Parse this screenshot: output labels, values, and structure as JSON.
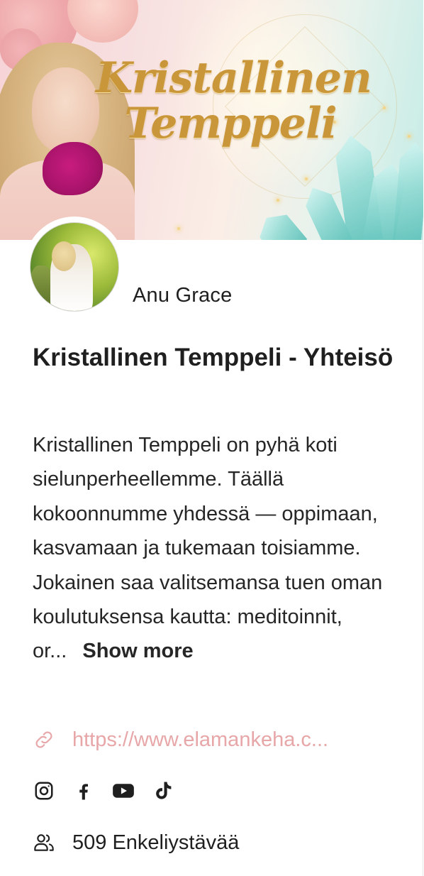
{
  "banner": {
    "title_line1": "Kristallinen",
    "title_line2": "Temppeli"
  },
  "owner": {
    "name": "Anu Grace"
  },
  "community": {
    "title": "Kristallinen Temppeli - Yhteisö",
    "description": "Kristallinen Temppeli on pyhä koti sielunperheellemme. Täällä kokoonnumme yhdessä — oppimaan, kasvamaan ja tukemaan toisiamme. Jokainen saa valitsemansa tuen oman koulutuksensa kautta: meditoinnit, or...",
    "show_more_label": "Show more",
    "link_text": "https://www.elamankeha.c...",
    "members_text": "509 Enkeliystävää"
  },
  "social": [
    {
      "icon": "instagram-icon"
    },
    {
      "icon": "facebook-icon"
    },
    {
      "icon": "youtube-icon"
    },
    {
      "icon": "tiktok-icon"
    }
  ],
  "colors": {
    "link": "#e7a6a8",
    "title_gold": "#c9963a",
    "text": "#1f1f1f"
  }
}
